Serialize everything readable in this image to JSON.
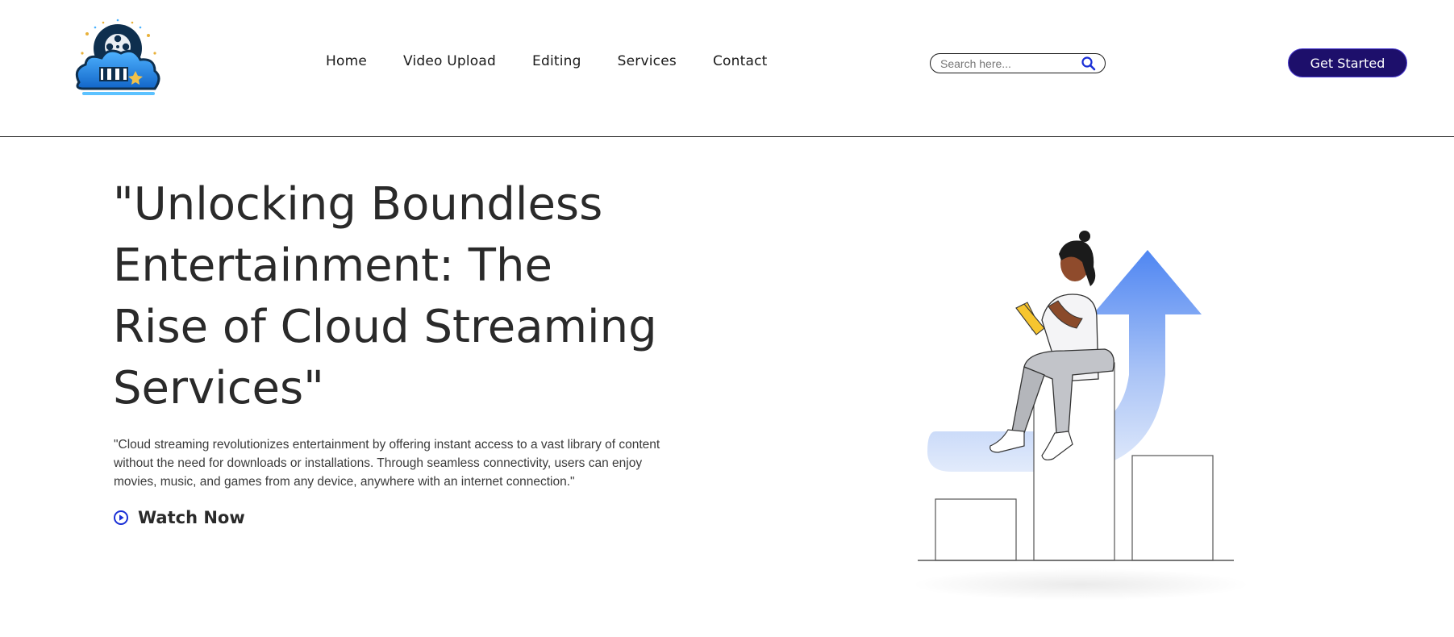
{
  "header": {
    "nav": [
      "Home",
      "Video Upload",
      "Editing",
      "Services",
      "Contact"
    ],
    "search_placeholder": "Search here...",
    "cta_label": "Get Started"
  },
  "hero": {
    "title": "\"Unlocking Boundless Entertainment: The Rise of Cloud Streaming Services\"",
    "description": "\"Cloud streaming revolutionizes entertainment by offering instant access to a vast library of content without the need for downloads or installations. Through seamless connectivity, users can enjoy movies, music, and games from any device, anywhere with an internet connection.\"",
    "watch_label": "Watch Now"
  },
  "colors": {
    "cta_bg": "#1d0f6b",
    "accent_blue": "#1a2fd6",
    "arrow_blue": "#4f86f2"
  },
  "icons": [
    "cloud-film-logo",
    "search-icon",
    "play-circle-icon",
    "growth-illustration"
  ]
}
